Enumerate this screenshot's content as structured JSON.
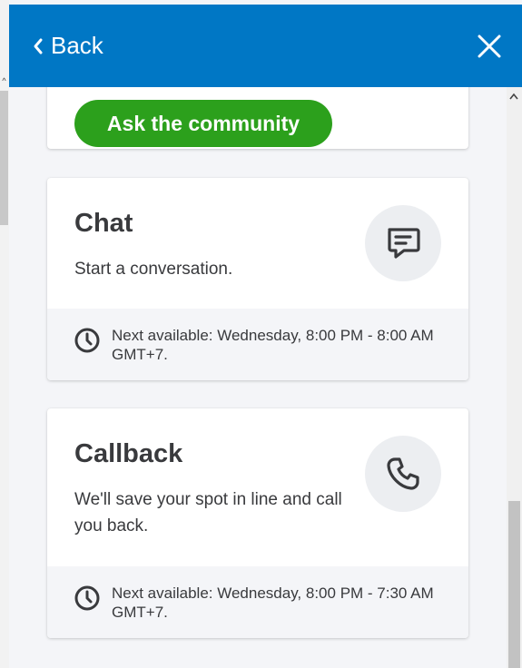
{
  "header": {
    "back_label": "Back",
    "bg_color": "#0077c5"
  },
  "community": {
    "button_label": "Ask the community",
    "button_color": "#2ca01c"
  },
  "chat": {
    "title": "Chat",
    "description": "Start a conversation.",
    "icon": "chat-bubble-icon",
    "availability": "Next available: Wednesday, 8:00 PM - 8:00 AM GMT+7."
  },
  "callback": {
    "title": "Callback",
    "description": "We'll save your spot in line and call you back.",
    "icon": "phone-icon",
    "availability": "Next available: Wednesday, 8:00 PM - 7:30 AM GMT+7."
  }
}
